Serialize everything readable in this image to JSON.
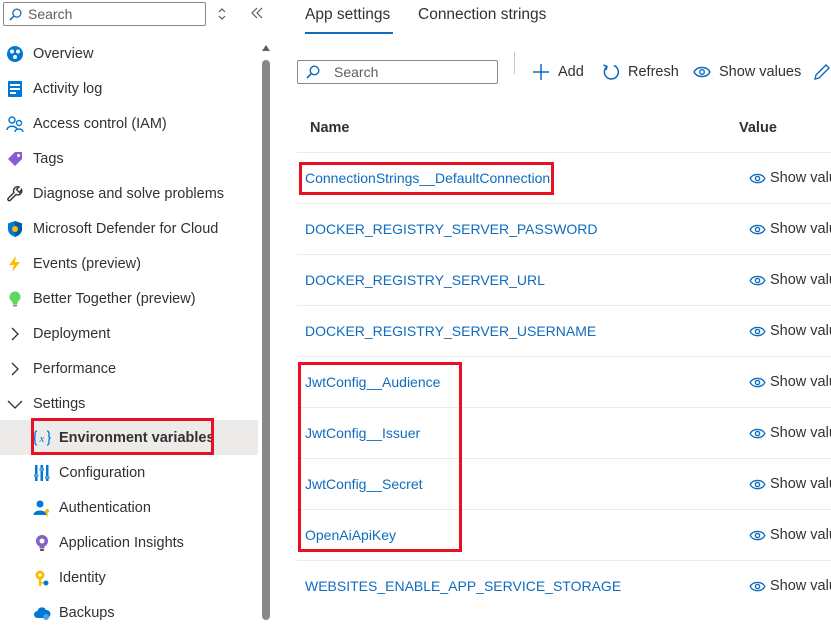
{
  "sidebar": {
    "search_placeholder": "Search",
    "items": [
      {
        "label": "Overview",
        "icon": "overview-icon"
      },
      {
        "label": "Activity log",
        "icon": "activity-log-icon"
      },
      {
        "label": "Access control (IAM)",
        "icon": "iam-people-icon"
      },
      {
        "label": "Tags",
        "icon": "tag-icon"
      },
      {
        "label": "Diagnose and solve problems",
        "icon": "wrench-icon"
      },
      {
        "label": "Microsoft Defender for Cloud",
        "icon": "shield-icon"
      },
      {
        "label": "Events (preview)",
        "icon": "lightning-icon"
      },
      {
        "label": "Better Together (preview)",
        "icon": "lightbulb-icon"
      },
      {
        "label": "Deployment",
        "icon": "chevron-right-icon"
      },
      {
        "label": "Performance",
        "icon": "chevron-right-icon"
      },
      {
        "label": "Settings",
        "icon": "chevron-down-icon"
      },
      {
        "label": "Environment variables",
        "icon": "variable-icon"
      },
      {
        "label": "Configuration",
        "icon": "sliders-icon"
      },
      {
        "label": "Authentication",
        "icon": "person-key-icon"
      },
      {
        "label": "Application Insights",
        "icon": "insights-bulb-icon"
      },
      {
        "label": "Identity",
        "icon": "identity-key-icon"
      },
      {
        "label": "Backups",
        "icon": "cloud-backup-icon"
      }
    ]
  },
  "tabs": {
    "app_settings": "App settings",
    "connection_strings": "Connection strings"
  },
  "toolbar": {
    "search_placeholder": "Search",
    "add": "Add",
    "refresh": "Refresh",
    "show_values": "Show values"
  },
  "table": {
    "headers": {
      "name": "Name",
      "value": "Value"
    },
    "rows": [
      {
        "name": "ConnectionStrings__DefaultConnection",
        "value": "Show valu"
      },
      {
        "name": "DOCKER_REGISTRY_SERVER_PASSWORD",
        "value": "Show valu"
      },
      {
        "name": "DOCKER_REGISTRY_SERVER_URL",
        "value": "Show valu"
      },
      {
        "name": "DOCKER_REGISTRY_SERVER_USERNAME",
        "value": "Show valu"
      },
      {
        "name": "JwtConfig__Audience",
        "value": "Show valu"
      },
      {
        "name": "JwtConfig__Issuer",
        "value": "Show valu"
      },
      {
        "name": "JwtConfig__Secret",
        "value": "Show valu"
      },
      {
        "name": "OpenAiApiKey",
        "value": "Show valu"
      },
      {
        "name": "WEBSITES_ENABLE_APP_SERVICE_STORAGE",
        "value": "Show valu"
      }
    ]
  },
  "colors": {
    "accent": "#0f6cbd",
    "highlight": "#e81123",
    "selected_bg": "#edebe9"
  }
}
